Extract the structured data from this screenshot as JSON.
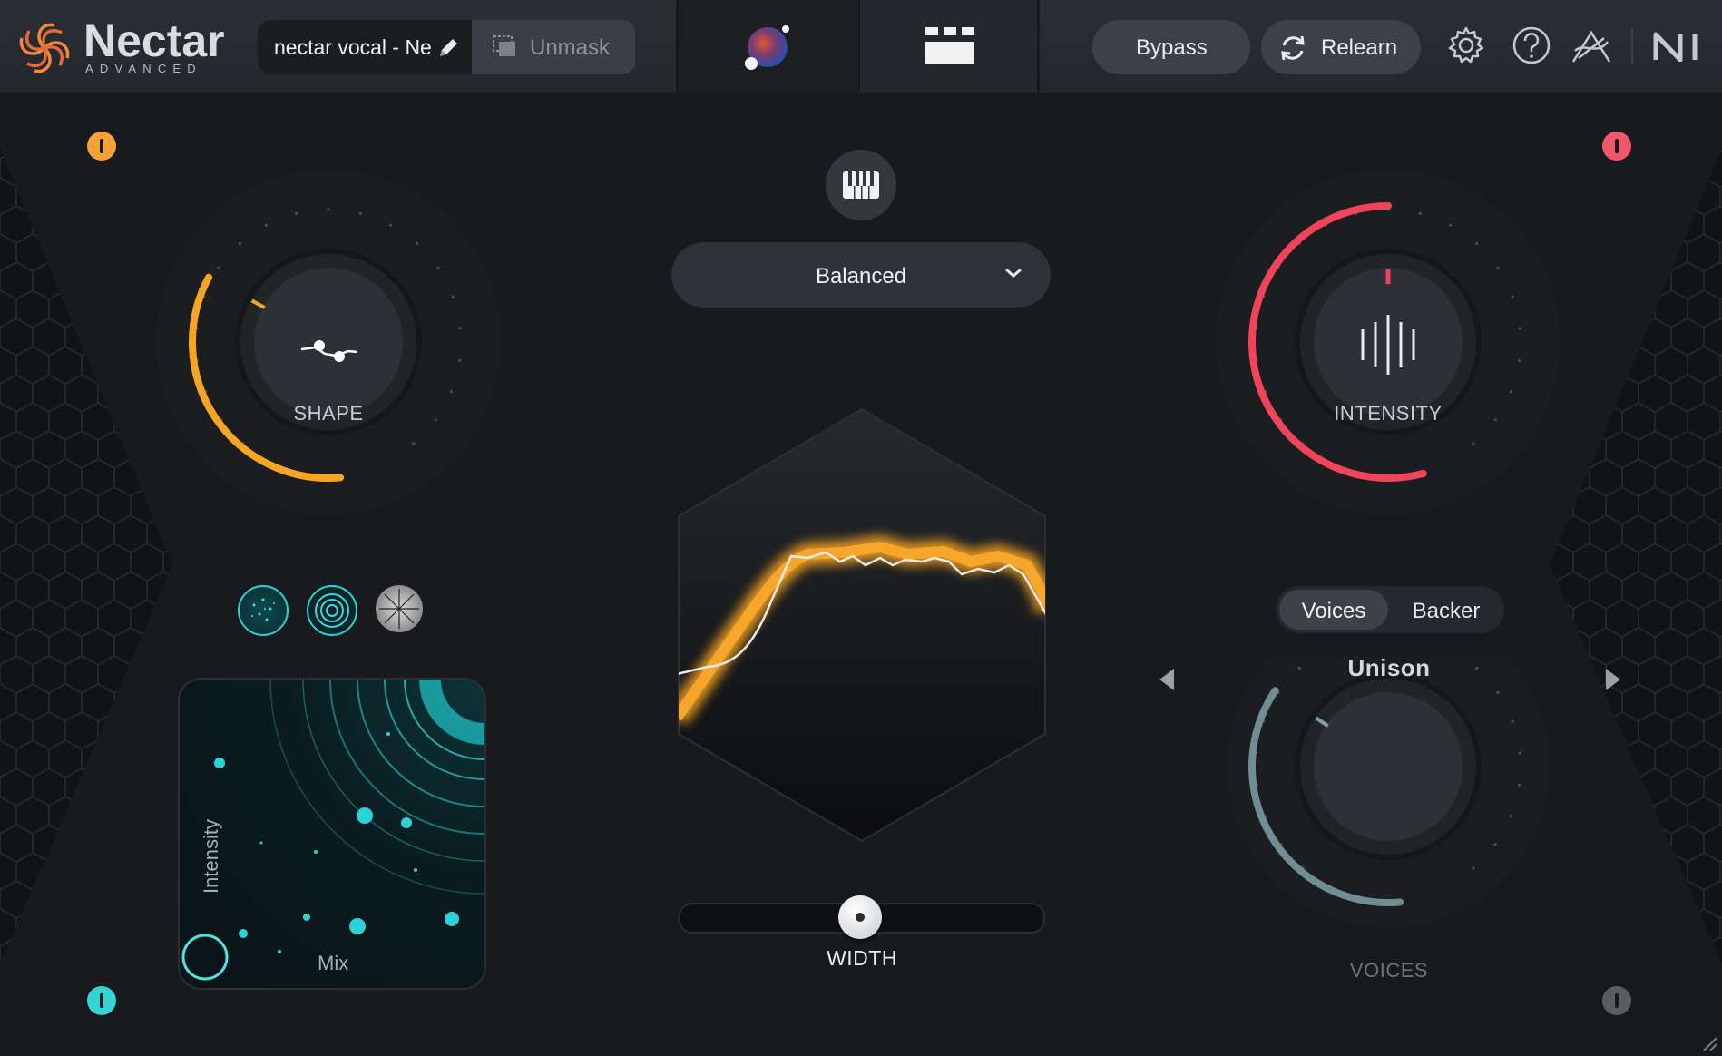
{
  "app": {
    "title": "Nectar",
    "subtitle": "ADVANCED"
  },
  "header": {
    "preset_name": "nectar vocal - Ne",
    "unmask_label": "Unmask",
    "bypass_label": "Bypass",
    "relearn_label": "Relearn"
  },
  "main": {
    "style_dropdown": "Balanced",
    "shape": {
      "label": "SHAPE",
      "value": 0.28,
      "color": "#f5a524"
    },
    "intensity": {
      "label": "INTENSITY",
      "value": 0.72,
      "color": "#f0445a"
    },
    "width": {
      "label": "WIDTH",
      "value": 0.5
    },
    "xy_pad": {
      "y_label": "Intensity",
      "x_label": "Mix"
    },
    "voices_toggle": {
      "options": [
        "Voices",
        "Backer"
      ],
      "selected": "Voices"
    },
    "voices": {
      "label": "VOICES",
      "mode": "Unison",
      "value": 0.3,
      "color": "#6f8e93"
    }
  },
  "colors": {
    "accent_orange": "#f5a524",
    "accent_red": "#f0445a",
    "accent_teal": "#2ad3d6",
    "background": "#181a1d"
  },
  "icons": [
    "pencil-icon",
    "unmask-icon",
    "orb-icon",
    "modules-icon",
    "settings-icon",
    "help-icon",
    "antenna-icon",
    "ni-logo",
    "piano-icon",
    "chevron-down-icon",
    "arrow-left-icon",
    "arrow-right-icon"
  ]
}
